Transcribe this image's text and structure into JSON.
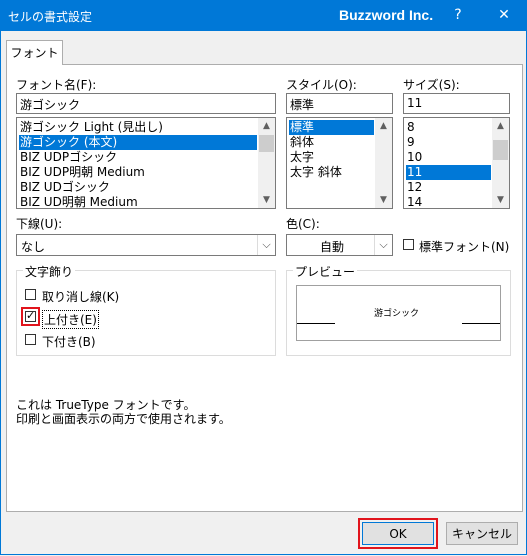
{
  "window": {
    "title": "セルの書式設定",
    "brand": "Buzzword Inc.",
    "help_label": "?",
    "close_label": "✕"
  },
  "tab": {
    "label": "フォント"
  },
  "font": {
    "label": "フォント名(F):",
    "value": "游ゴシック",
    "items": [
      "游ゴシック Light (見出し)",
      "游ゴシック (本文)",
      "BIZ UDPゴシック",
      "BIZ UDP明朝 Medium",
      "BIZ UDゴシック",
      "BIZ UD明朝 Medium"
    ],
    "selected_index": 1
  },
  "style": {
    "label": "スタイル(O):",
    "value": "標準",
    "items": [
      "標準",
      "斜体",
      "太字",
      "太字 斜体"
    ],
    "selected_index": 0
  },
  "size": {
    "label": "サイズ(S):",
    "value": "11",
    "items": [
      "8",
      "9",
      "10",
      "11",
      "12",
      "14"
    ],
    "selected_index": 3
  },
  "underline": {
    "label": "下線(U):",
    "value": "なし"
  },
  "color": {
    "label": "色(C):",
    "value": "自動"
  },
  "normal_font": {
    "label": "標準フォント(N)",
    "checked": false
  },
  "effects": {
    "label": "文字飾り",
    "strikethrough": {
      "label": "取り消し線(K)",
      "checked": false
    },
    "superscript": {
      "label": "上付き(E)",
      "checked": true
    },
    "subscript": {
      "label": "下付き(B)",
      "checked": false
    }
  },
  "preview": {
    "label": "プレビュー",
    "sample": "游ゴシック"
  },
  "info": {
    "line1": "これは TrueType フォントです。",
    "line2": "印刷と画面表示の両方で使用されます。"
  },
  "buttons": {
    "ok": "OK",
    "cancel": "キャンセル"
  },
  "colors": {
    "titlebar": "#0078d7",
    "selection": "#0078d7",
    "highlight": "#e1141c"
  }
}
